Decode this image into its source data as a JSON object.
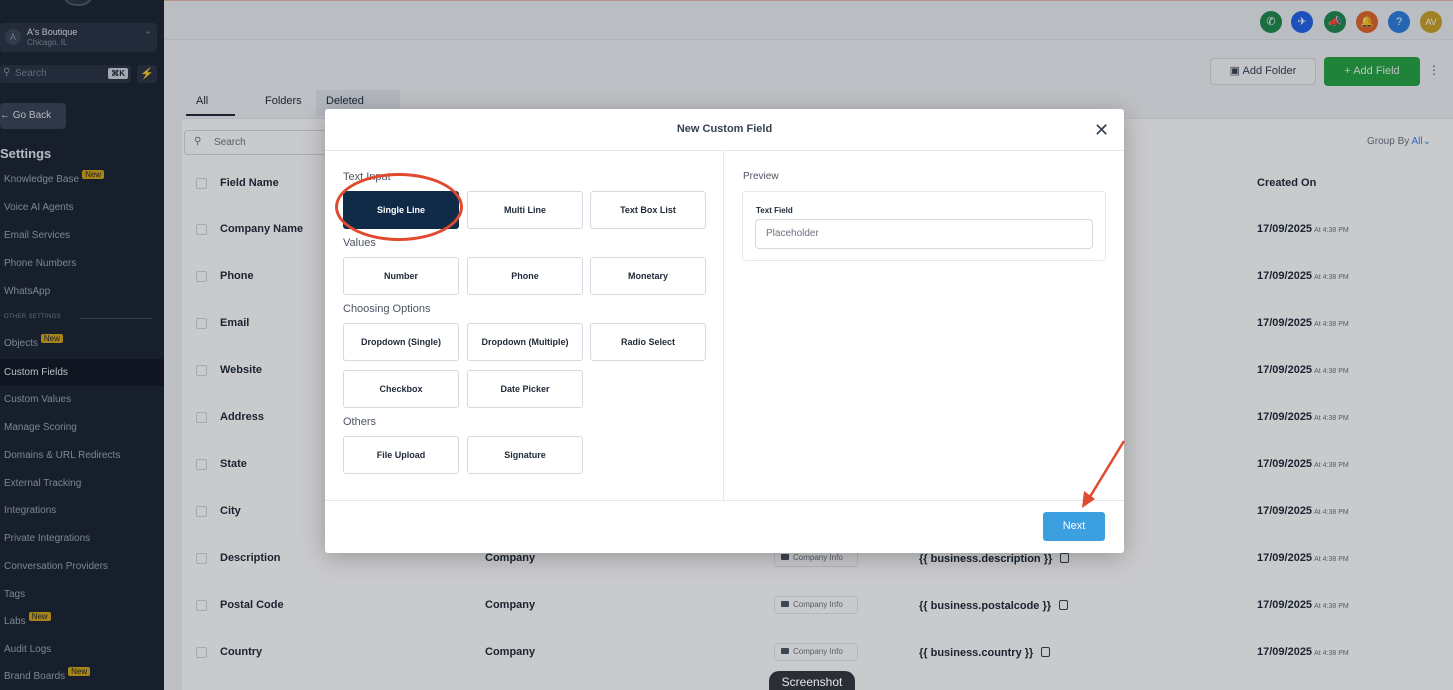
{
  "sidebar": {
    "account": {
      "initial": "A",
      "name": "A's Boutique",
      "location": "Chicago, IL"
    },
    "search": {
      "placeholder": "Search",
      "shortcut": "⌘K"
    },
    "go_back": "← Go Back",
    "heading": "Settings",
    "items": [
      {
        "label": "Knowledge Base",
        "badge": "New"
      },
      {
        "label": "Voice AI Agents"
      },
      {
        "label": "Email Services"
      },
      {
        "label": "Phone Numbers"
      },
      {
        "label": "WhatsApp"
      },
      {
        "label": "Objects",
        "badge": "New"
      },
      {
        "label": "Custom Fields",
        "active": true
      },
      {
        "label": "Custom Values"
      },
      {
        "label": "Manage Scoring"
      },
      {
        "label": "Domains & URL Redirects"
      },
      {
        "label": "External Tracking"
      },
      {
        "label": "Integrations"
      },
      {
        "label": "Private Integrations"
      },
      {
        "label": "Conversation Providers"
      },
      {
        "label": "Tags"
      },
      {
        "label": "Labs",
        "badge": "New"
      },
      {
        "label": "Audit Logs"
      },
      {
        "label": "Brand Boards",
        "badge": "New"
      }
    ],
    "other_settings": "OTHER SETTINGS"
  },
  "topbar": {
    "icons": [
      {
        "name": "phone-icon",
        "color": "#1f8a4c",
        "glyph": "✆"
      },
      {
        "name": "rocket-icon",
        "color": "#2563eb",
        "glyph": "✈"
      },
      {
        "name": "megaphone-icon",
        "color": "#1f8a4c",
        "glyph": "📣"
      },
      {
        "name": "bell-icon",
        "color": "#e2662b",
        "glyph": "🔔"
      },
      {
        "name": "help-icon",
        "color": "#2f7de1",
        "glyph": "?"
      },
      {
        "name": "user-avatar",
        "color": "#c9a227",
        "glyph": "AV"
      }
    ]
  },
  "toolbar": {
    "add_folder": "Add Folder",
    "add_field": "+ Add Field"
  },
  "tabs": {
    "all_fields": "All Fields",
    "folders": "Folders",
    "deleted_fields": "Deleted Fields"
  },
  "table": {
    "search_placeholder": "Search",
    "group_by_label": "Group By",
    "group_by_value": "All",
    "headers": {
      "field_name": "Field Name",
      "created_on": "Created On"
    },
    "rows": [
      {
        "name": "Company Name",
        "date": "17/09/2025",
        "time": "At 4:38 PM"
      },
      {
        "name": "Phone",
        "date": "17/09/2025",
        "time": "At 4:38 PM"
      },
      {
        "name": "Email",
        "date": "17/09/2025",
        "time": "At 4:38 PM"
      },
      {
        "name": "Website",
        "date": "17/09/2025",
        "time": "At 4:38 PM"
      },
      {
        "name": "Address",
        "date": "17/09/2025",
        "time": "At 4:38 PM"
      },
      {
        "name": "State",
        "date": "17/09/2025",
        "time": "At 4:38 PM"
      },
      {
        "name": "City",
        "date": "17/09/2025",
        "time": "At 4:38 PM"
      },
      {
        "name": "Description",
        "object": "Company",
        "folder": "Company Info",
        "key": "{{ business.description }}",
        "date": "17/09/2025",
        "time": "At 4:38 PM"
      },
      {
        "name": "Postal Code",
        "object": "Company",
        "folder": "Company Info",
        "key": "{{ business.postalcode }}",
        "date": "17/09/2025",
        "time": "At 4:38 PM"
      },
      {
        "name": "Country",
        "object": "Company",
        "folder": "Company Info",
        "key": "{{ business.country }}",
        "date": "17/09/2025",
        "time": "At 4:38 PM"
      }
    ]
  },
  "modal": {
    "title": "New Custom Field",
    "sections": {
      "text_input": "Text Input",
      "values": "Values",
      "choosing_options": "Choosing Options",
      "others": "Others"
    },
    "options": {
      "single_line": "Single Line",
      "multi_line": "Multi Line",
      "text_box_list": "Text Box List",
      "number": "Number",
      "phone": "Phone",
      "monetary": "Monetary",
      "dropdown_single": "Dropdown (Single)",
      "dropdown_multiple": "Dropdown (Multiple)",
      "radio_select": "Radio Select",
      "checkbox": "Checkbox",
      "date_picker": "Date Picker",
      "file_upload": "File Upload",
      "signature": "Signature"
    },
    "preview": {
      "label": "Preview",
      "field_label": "Text Field",
      "placeholder": "Placeholder"
    },
    "next": "Next"
  },
  "tooltip": "Screenshot",
  "colors": {
    "selected_option": "#0f2b47",
    "next_button": "#3b9fe0",
    "add_field_button": "#27a544",
    "annotation": "#e04a2f"
  }
}
